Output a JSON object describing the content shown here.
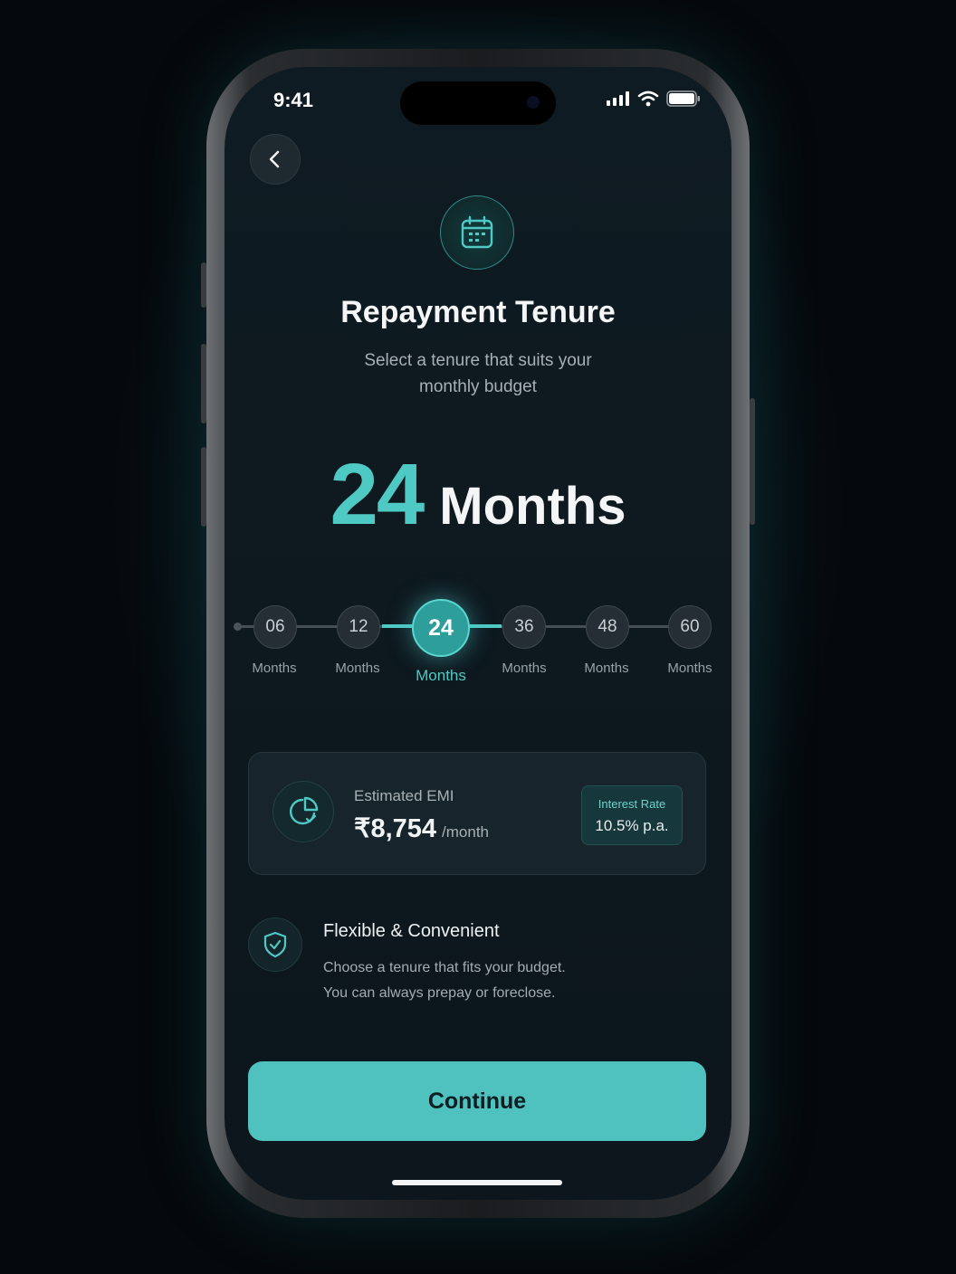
{
  "status_bar": {
    "time": "9:41"
  },
  "header": {
    "icon": "calendar-icon",
    "title": "Repayment Tenure",
    "subtitle": "Select a tenure that suits your monthly budget"
  },
  "selected": {
    "value": "24",
    "unit": "Months"
  },
  "tenure_options": [
    {
      "value": "06",
      "label": "Months",
      "selected": false
    },
    {
      "value": "12",
      "label": "Months",
      "selected": false
    },
    {
      "value": "24",
      "label": "Months",
      "selected": true
    },
    {
      "value": "36",
      "label": "Months",
      "selected": false
    },
    {
      "value": "48",
      "label": "Months",
      "selected": false
    },
    {
      "value": "60",
      "label": "Months",
      "selected": false
    }
  ],
  "emi": {
    "label": "Estimated EMI",
    "amount": "₹8,754",
    "per": "/month",
    "rate_label": "Interest Rate",
    "rate_value": "10.5% p.a."
  },
  "feature": {
    "icon": "shield-check-icon",
    "title": "Flexible & Convenient",
    "line1": "Choose a tenure that fits your budget.",
    "line2": "You can always prepay or foreclose."
  },
  "cta": {
    "label": "Continue"
  },
  "colors": {
    "accent": "#4fc9c4",
    "background": "#0f1b22",
    "button": "#4fc2c0"
  }
}
